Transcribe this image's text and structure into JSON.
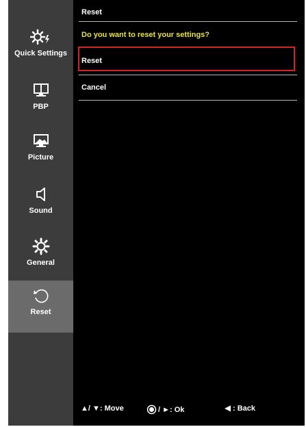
{
  "sidebar": {
    "items": [
      {
        "label": "Quick Settings",
        "icon": "quick-settings-icon"
      },
      {
        "label": "PBP",
        "icon": "pbp-icon"
      },
      {
        "label": "Picture",
        "icon": "picture-icon"
      },
      {
        "label": "Sound",
        "icon": "sound-icon"
      },
      {
        "label": "General",
        "icon": "general-gear-icon"
      },
      {
        "label": "Reset",
        "icon": "reset-icon",
        "active": true
      }
    ]
  },
  "main": {
    "title": "Reset",
    "question": "Do you want to reset your settings?",
    "options": [
      {
        "label": "Reset",
        "selected": true
      },
      {
        "label": "Cancel",
        "selected": false
      }
    ]
  },
  "footer": {
    "move": "▲/ ▼: Move",
    "ok": "/ ►: Ok",
    "back": ": Back"
  },
  "colors": {
    "sidebar_bg": "#3c3c3c",
    "active_bg": "#6b6b6b",
    "question_text": "#e8e24c",
    "selection_border": "#d1242a"
  }
}
